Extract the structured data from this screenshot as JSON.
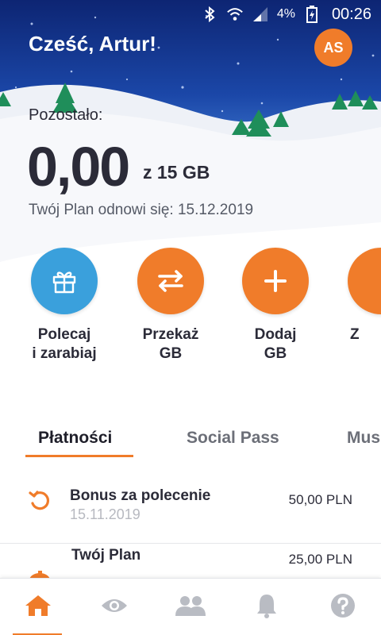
{
  "status_bar": {
    "battery_percent": "4%",
    "time": "00:26",
    "icons": [
      "bluetooth-icon",
      "wifi-icon",
      "signal-icon",
      "battery-charging-icon"
    ]
  },
  "header": {
    "greeting": "Cześć, Artur!",
    "avatar_initials": "AS"
  },
  "balance": {
    "label": "Pozostało:",
    "value": "0,00",
    "quota": "z 15 GB",
    "renewal": "Twój Plan odnowi się: 15.12.2019"
  },
  "actions": [
    {
      "line1": "Polecaj",
      "line2": "i zarabiaj",
      "icon": "gift-icon",
      "color": "#3aa0dc"
    },
    {
      "line1": "Przekaż",
      "line2": "GB",
      "icon": "transfer-icon",
      "color": "#f07c2a"
    },
    {
      "line1": "Dodaj",
      "line2": "GB",
      "icon": "plus-icon",
      "color": "#f07c2a"
    },
    {
      "line1": "Z",
      "line2": "",
      "icon": "partial-action-icon",
      "color": "#f07c2a"
    }
  ],
  "tabs": [
    {
      "label": "Płatności",
      "active": true
    },
    {
      "label": "Social Pass",
      "active": false
    },
    {
      "label": "Mus",
      "active": false
    }
  ],
  "payments": [
    {
      "title": "Bonus za polecenie",
      "date": "15.11.2019",
      "amount": "50,00 PLN",
      "icon": "refund-icon"
    },
    {
      "title": "Twój Plan",
      "date": "",
      "amount": "25,00 PLN",
      "icon": "piggy-bank-icon"
    }
  ],
  "bottom_nav": [
    {
      "icon": "home-icon",
      "active": true
    },
    {
      "icon": "eye-icon",
      "active": false
    },
    {
      "icon": "people-icon",
      "active": false
    },
    {
      "icon": "bell-icon",
      "active": false
    },
    {
      "icon": "help-icon",
      "active": false
    }
  ],
  "colors": {
    "accent": "#f07c2a",
    "blue_action": "#3aa0dc",
    "sky": "#1a44a6",
    "text_dark": "#2b2b38",
    "nav_inactive": "#b9bcc3"
  }
}
